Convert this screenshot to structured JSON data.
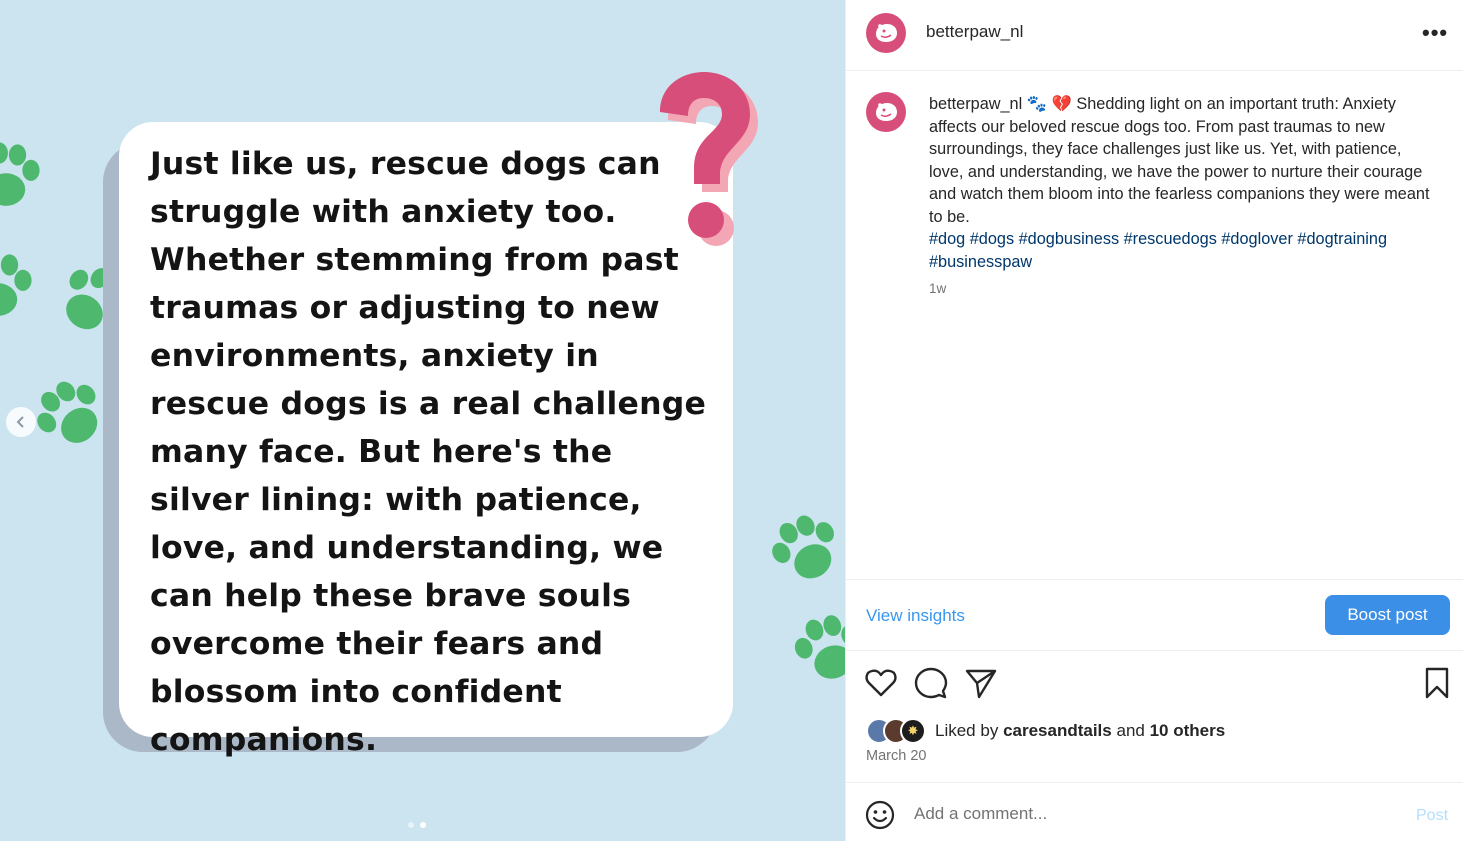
{
  "media": {
    "card_text": "Just like us, rescue dogs can struggle with anxiety too. Whether stemming from past traumas or adjusting to new environments, anxiety in rescue dogs is a real challenge many face. But here's the silver lining: with patience, love, and understanding, we can help these brave souls overcome their fears and blossom into confident companions.",
    "background_color": "#cbe4f0",
    "paw_color": "#4fb86f",
    "question_mark_color": "#d84e7a",
    "slide_count": 2,
    "active_slide": 2
  },
  "header": {
    "username": "betterpaw_nl",
    "more_icon": "more-horizontal-icon"
  },
  "caption": {
    "username": "betterpaw_nl",
    "emoji": "🐾 💔",
    "text": "Shedding light on an important truth: Anxiety affects our beloved rescue dogs too. From past traumas to new surroundings, they face challenges just like us. Yet, with patience, love, and understanding, we have the power to nurture their courage and watch them bloom into the fearless companions they were meant to be.",
    "hashtags": "#dog #dogs #dogbusiness #rescuedogs #doglover #dogtraining #businesspaw",
    "time_ago": "1w"
  },
  "insights": {
    "view_label": "View insights",
    "boost_label": "Boost post"
  },
  "likes": {
    "prefix": "Liked by",
    "user": "caresandtails",
    "joiner": "and",
    "others": "10 others",
    "date": "March 20"
  },
  "comment": {
    "placeholder": "Add a comment...",
    "post_label": "Post"
  },
  "colors": {
    "accent": "#3b8fe6",
    "avatar": "#d84e7a"
  }
}
